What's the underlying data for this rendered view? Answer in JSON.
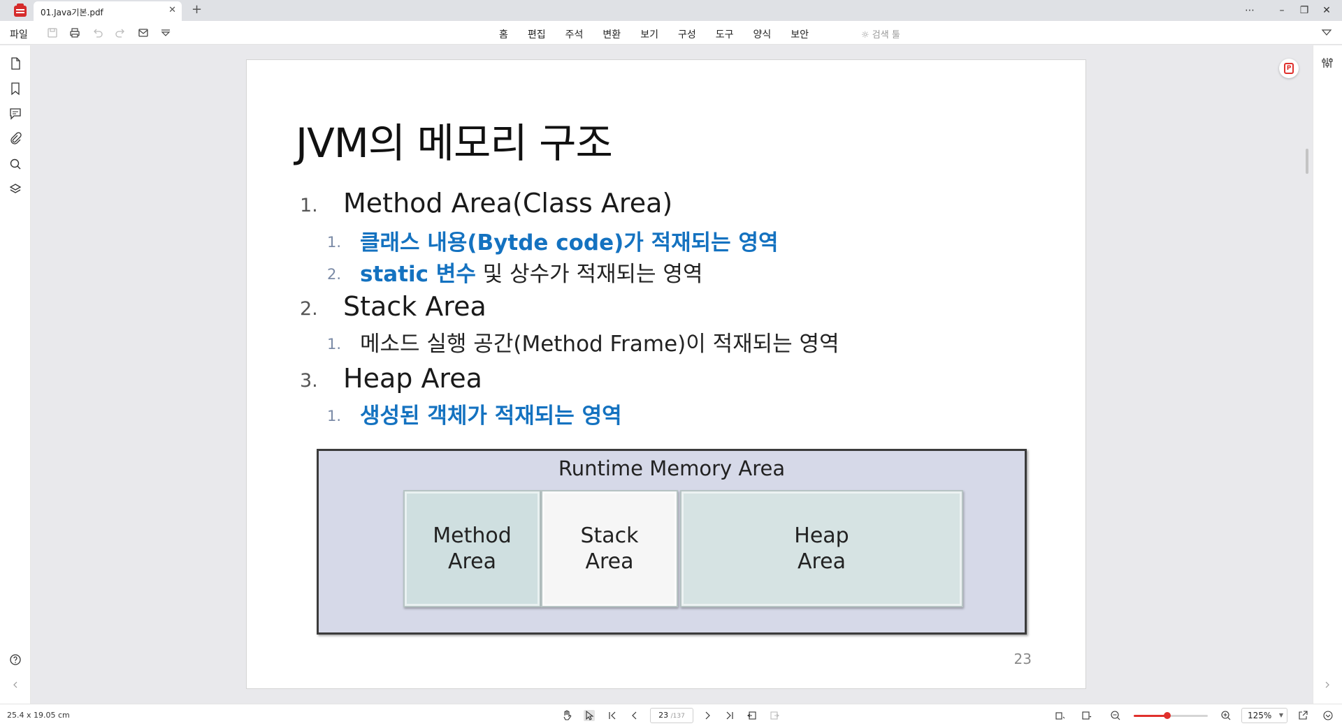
{
  "tab": {
    "title": "01.Java기본.pdf"
  },
  "menubar": {
    "file": "파일",
    "items": [
      "홈",
      "편집",
      "주석",
      "변환",
      "보기",
      "구성",
      "도구",
      "양식",
      "보안"
    ],
    "search_tool": "검색 툴"
  },
  "slide": {
    "title": "JVM의 메모리 구조",
    "items": [
      {
        "num": "1.",
        "label": "Method Area(Class Area)",
        "sub": [
          {
            "num": "1.",
            "bold": "클래스 내용(Bytde code)가 적재되는 영역",
            "rest": ""
          },
          {
            "num": "2.",
            "bold": "static 변수",
            "rest": " 및 상수가 적재되는 영역"
          }
        ]
      },
      {
        "num": "2.",
        "label": "Stack Area",
        "sub": [
          {
            "num": "1.",
            "bold": "",
            "rest": "메소드 실행 공간(Method Frame)이 적재되는 영역"
          }
        ]
      },
      {
        "num": "3.",
        "label": "Heap Area",
        "sub": [
          {
            "num": "1.",
            "bold": "생성된 객체가 적재되는 영역",
            "rest": ""
          }
        ]
      }
    ],
    "diagram": {
      "title": "Runtime Memory Area",
      "method": "Method\nArea",
      "stack": "Stack\nArea",
      "heap": "Heap\nArea"
    },
    "page_number": "23"
  },
  "statusbar": {
    "page_size": "25.4 x 19.05 cm",
    "current_page": "23",
    "total_pages": "/137",
    "zoom": "125%",
    "zoom_level": 0.45
  },
  "colors": {
    "accent": "#e0302c",
    "slide_blue": "#1472c0"
  },
  "icons": [
    "app-logo-icon",
    "close-icon",
    "plus-icon",
    "more-icon",
    "minimize-icon",
    "restore-icon",
    "window-close-icon",
    "save-icon",
    "print-icon",
    "undo-icon",
    "redo-icon",
    "mail-icon",
    "dropdown-icon",
    "lightbulb-icon",
    "chevron-down-icon",
    "page-icon",
    "bookmark-icon",
    "comment-icon",
    "attachment-icon",
    "search-icon",
    "layers-icon",
    "help-icon",
    "chevron-left-icon",
    "chevron-right-icon",
    "settings-sliders-icon",
    "ai-pdf-icon",
    "hand-icon",
    "select-icon",
    "first-page-icon",
    "prev-page-icon",
    "next-page-icon",
    "last-page-icon",
    "back-icon",
    "forward-icon",
    "rotate-icon",
    "page-view-icon",
    "zoom-out-icon",
    "zoom-in-icon",
    "fit-icon",
    "collapse-icon"
  ]
}
